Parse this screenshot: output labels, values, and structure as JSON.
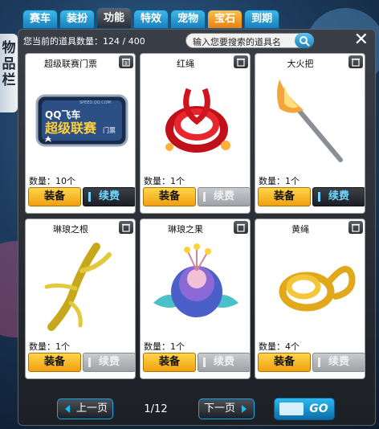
{
  "side_tab": {
    "label": "物品栏"
  },
  "tabs": [
    {
      "label": "赛车"
    },
    {
      "label": "装扮"
    },
    {
      "label": "功能"
    },
    {
      "label": "特效"
    },
    {
      "label": "宠物"
    },
    {
      "label": "宝石"
    },
    {
      "label": "到期"
    }
  ],
  "header": {
    "count_text": "您当前的道具数量：124 / 400",
    "search_placeholder": "输入您要搜索的道具名"
  },
  "items": [
    {
      "name": "超级联赛门票",
      "qty": "数量：10个",
      "equip": "装备",
      "renew": "续费",
      "renew_enabled": true,
      "icon": "ticket-icon"
    },
    {
      "name": "红绳",
      "qty": "数量：1个",
      "equip": "装备",
      "renew": "续费",
      "renew_enabled": false,
      "icon": "red-rope-icon"
    },
    {
      "name": "大火把",
      "qty": "数量：1个",
      "equip": "装备",
      "renew": "续费",
      "renew_enabled": true,
      "icon": "torch-icon"
    },
    {
      "name": "琳琅之根",
      "qty": "数量：1个",
      "equip": "装备",
      "renew": "续费",
      "renew_enabled": false,
      "icon": "root-icon"
    },
    {
      "name": "琳琅之果",
      "qty": "数量：1个",
      "equip": "装备",
      "renew": "续费",
      "renew_enabled": false,
      "icon": "fruit-flower-icon"
    },
    {
      "name": "黄绳",
      "qty": "数量：4个",
      "equip": "装备",
      "renew": "续费",
      "renew_enabled": false,
      "icon": "yellow-rope-icon"
    }
  ],
  "pager": {
    "prev": "上一页",
    "page": "1/12",
    "next": "下一页",
    "go": "GO"
  },
  "ticket_art": {
    "line1": "QQ飞车",
    "line2": "超级联赛",
    "line3": "门票",
    "url": "SPEED.QQ.COM"
  }
}
